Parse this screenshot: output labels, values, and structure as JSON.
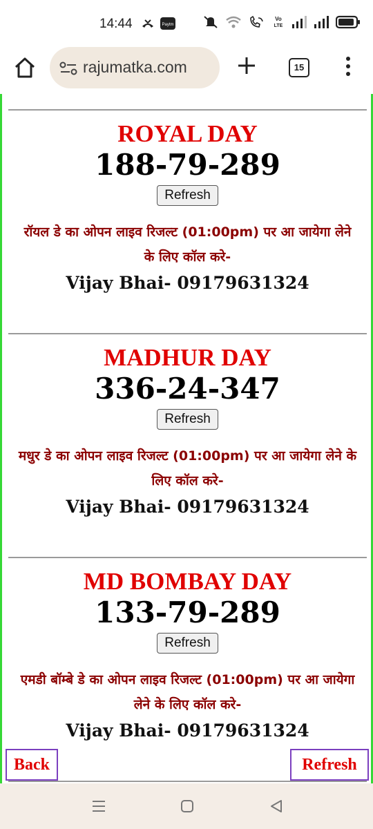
{
  "status_bar": {
    "time": "14:44",
    "left_icons": [
      "missed-call-icon",
      "paytm-icon"
    ],
    "right_icons": [
      "mute-icon",
      "wifi-icon",
      "wifi-calling-icon",
      "volte-icon",
      "signal-icon",
      "signal-icon-2",
      "battery-icon"
    ]
  },
  "browser": {
    "url": "rajumatka.com",
    "tab_count": "15"
  },
  "sections": [
    {
      "title": "ROYAL DAY",
      "number": "188-79-289",
      "refresh_label": "Refresh",
      "notice": "रॉयल डे का ओपन लाइव रिजल्ट (01:00pm) पर आ जायेगा लेने के लिए कॉल करे-",
      "contact": "Vijay Bhai- 09179631324"
    },
    {
      "title": "MADHUR DAY",
      "number": "336-24-347",
      "refresh_label": "Refresh",
      "notice": "मधुर डे का ओपन लाइव रिजल्ट (01:00pm) पर आ जायेगा लेने के लिए कॉल करे-",
      "contact": "Vijay Bhai- 09179631324"
    },
    {
      "title": "MD BOMBAY DAY",
      "number": "133-79-289",
      "refresh_label": "Refresh",
      "notice": "एमडी बॉम्बे डे का ओपन लाइव रिजल्ट (01:00pm) पर आ जायेगा लेने के लिए कॉल करे-",
      "contact": "Vijay Bhai- 09179631324"
    }
  ],
  "floating": {
    "back_label": "Back",
    "refresh_label": "Refresh"
  },
  "colors": {
    "title_red": "#e00000",
    "notice_maroon": "#8b0000",
    "page_border_green": "#36d836",
    "floating_border_purple": "#7b3fbf"
  }
}
